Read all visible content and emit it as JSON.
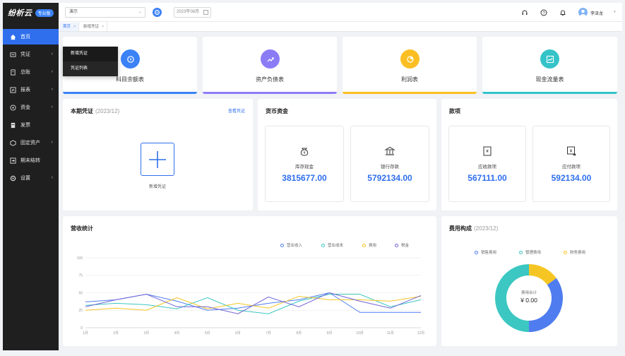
{
  "app": {
    "logo": "纷析云",
    "badge": "专业版"
  },
  "sidebar": {
    "items": [
      {
        "label": "首页",
        "icon": "home-icon",
        "active": true,
        "arrow": false
      },
      {
        "label": "凭证",
        "icon": "voucher-icon",
        "active": false,
        "arrow": true
      },
      {
        "label": "总账",
        "icon": "ledger-icon",
        "active": false,
        "arrow": true
      },
      {
        "label": "报表",
        "icon": "report-icon",
        "active": false,
        "arrow": true
      },
      {
        "label": "资金",
        "icon": "fund-icon",
        "active": false,
        "arrow": true
      },
      {
        "label": "发票",
        "icon": "invoice-icon",
        "active": false,
        "arrow": false
      },
      {
        "label": "固定资产",
        "icon": "asset-icon",
        "active": false,
        "arrow": true
      },
      {
        "label": "期末结转",
        "icon": "carry-forward-icon",
        "active": false,
        "arrow": false
      },
      {
        "label": "设置",
        "icon": "settings-icon",
        "active": false,
        "arrow": true
      }
    ],
    "arrow_glyph": "›"
  },
  "submenu": {
    "items": [
      "新增凭证",
      "凭证列表"
    ]
  },
  "topbar": {
    "company": "演示",
    "period": "2023年08月",
    "user": "李泽龙"
  },
  "tabs": [
    {
      "label": "首页",
      "active": true
    },
    {
      "label": "新增凭证",
      "active": false
    }
  ],
  "reports": [
    {
      "label": "科目余额表",
      "color": "#3b82f6",
      "icon": "balance-icon"
    },
    {
      "label": "资产负债表",
      "color": "#8b7cf6",
      "icon": "trend-up-icon"
    },
    {
      "label": "利润表",
      "color": "#fbbf24",
      "icon": "pie-icon"
    },
    {
      "label": "现金流量表",
      "color": "#34c3c8",
      "icon": "chart-line-icon"
    }
  ],
  "voucher": {
    "title": "本期凭证",
    "period": "(2023/12)",
    "link": "查看凭证",
    "add_label": "新增凭证"
  },
  "money": {
    "title": "货币资金",
    "items": [
      {
        "label": "库存现金",
        "value": "3815677.00",
        "icon": "moneybag-icon"
      },
      {
        "label": "银行存款",
        "value": "5792134.00",
        "icon": "bank-icon"
      }
    ]
  },
  "receivables": {
    "title": "款项",
    "items": [
      {
        "label": "应收款项",
        "value": "567111.00",
        "icon": "receivable-icon"
      },
      {
        "label": "应付款项",
        "value": "592134.00",
        "icon": "payable-icon"
      }
    ]
  },
  "revenue": {
    "title": "营收统计",
    "chart_data": {
      "type": "line",
      "categories": [
        "1月",
        "2月",
        "3月",
        "4月",
        "5月",
        "6月",
        "7月",
        "8月",
        "9月",
        "10月",
        "11月",
        "12月"
      ],
      "ylim": [
        0,
        100
      ],
      "yticks": [
        0,
        25,
        50,
        75,
        100
      ],
      "grid": true,
      "legend": "top-right",
      "series": [
        {
          "name": "营业收入",
          "color": "#4f7df0",
          "values": [
            37,
            40,
            48,
            38,
            25,
            28,
            35,
            40,
            50,
            22,
            22,
            22
          ]
        },
        {
          "name": "营业成本",
          "color": "#3cc7c2",
          "values": [
            32,
            35,
            33,
            27,
            43,
            25,
            20,
            38,
            48,
            48,
            30,
            40
          ]
        },
        {
          "name": "费用",
          "color": "#f5c623",
          "values": [
            25,
            28,
            25,
            43,
            27,
            35,
            28,
            45,
            40,
            40,
            38,
            45
          ]
        },
        {
          "name": "税金",
          "color": "#6f63d8",
          "values": [
            30,
            40,
            48,
            30,
            30,
            20,
            44,
            30,
            50,
            38,
            28,
            46
          ]
        }
      ]
    }
  },
  "expense": {
    "title": "费用构成",
    "period": "(2023/12)",
    "center_label": "费用合计",
    "center_value": "¥ 0.00",
    "chart_data": {
      "type": "pie",
      "legend": "top",
      "labels": [
        "销售费用",
        "管理费用",
        "财务费用"
      ],
      "colors": [
        "#4f7df0",
        "#3cc7c2",
        "#f5c623"
      ],
      "values": [
        35,
        50,
        15
      ]
    }
  }
}
